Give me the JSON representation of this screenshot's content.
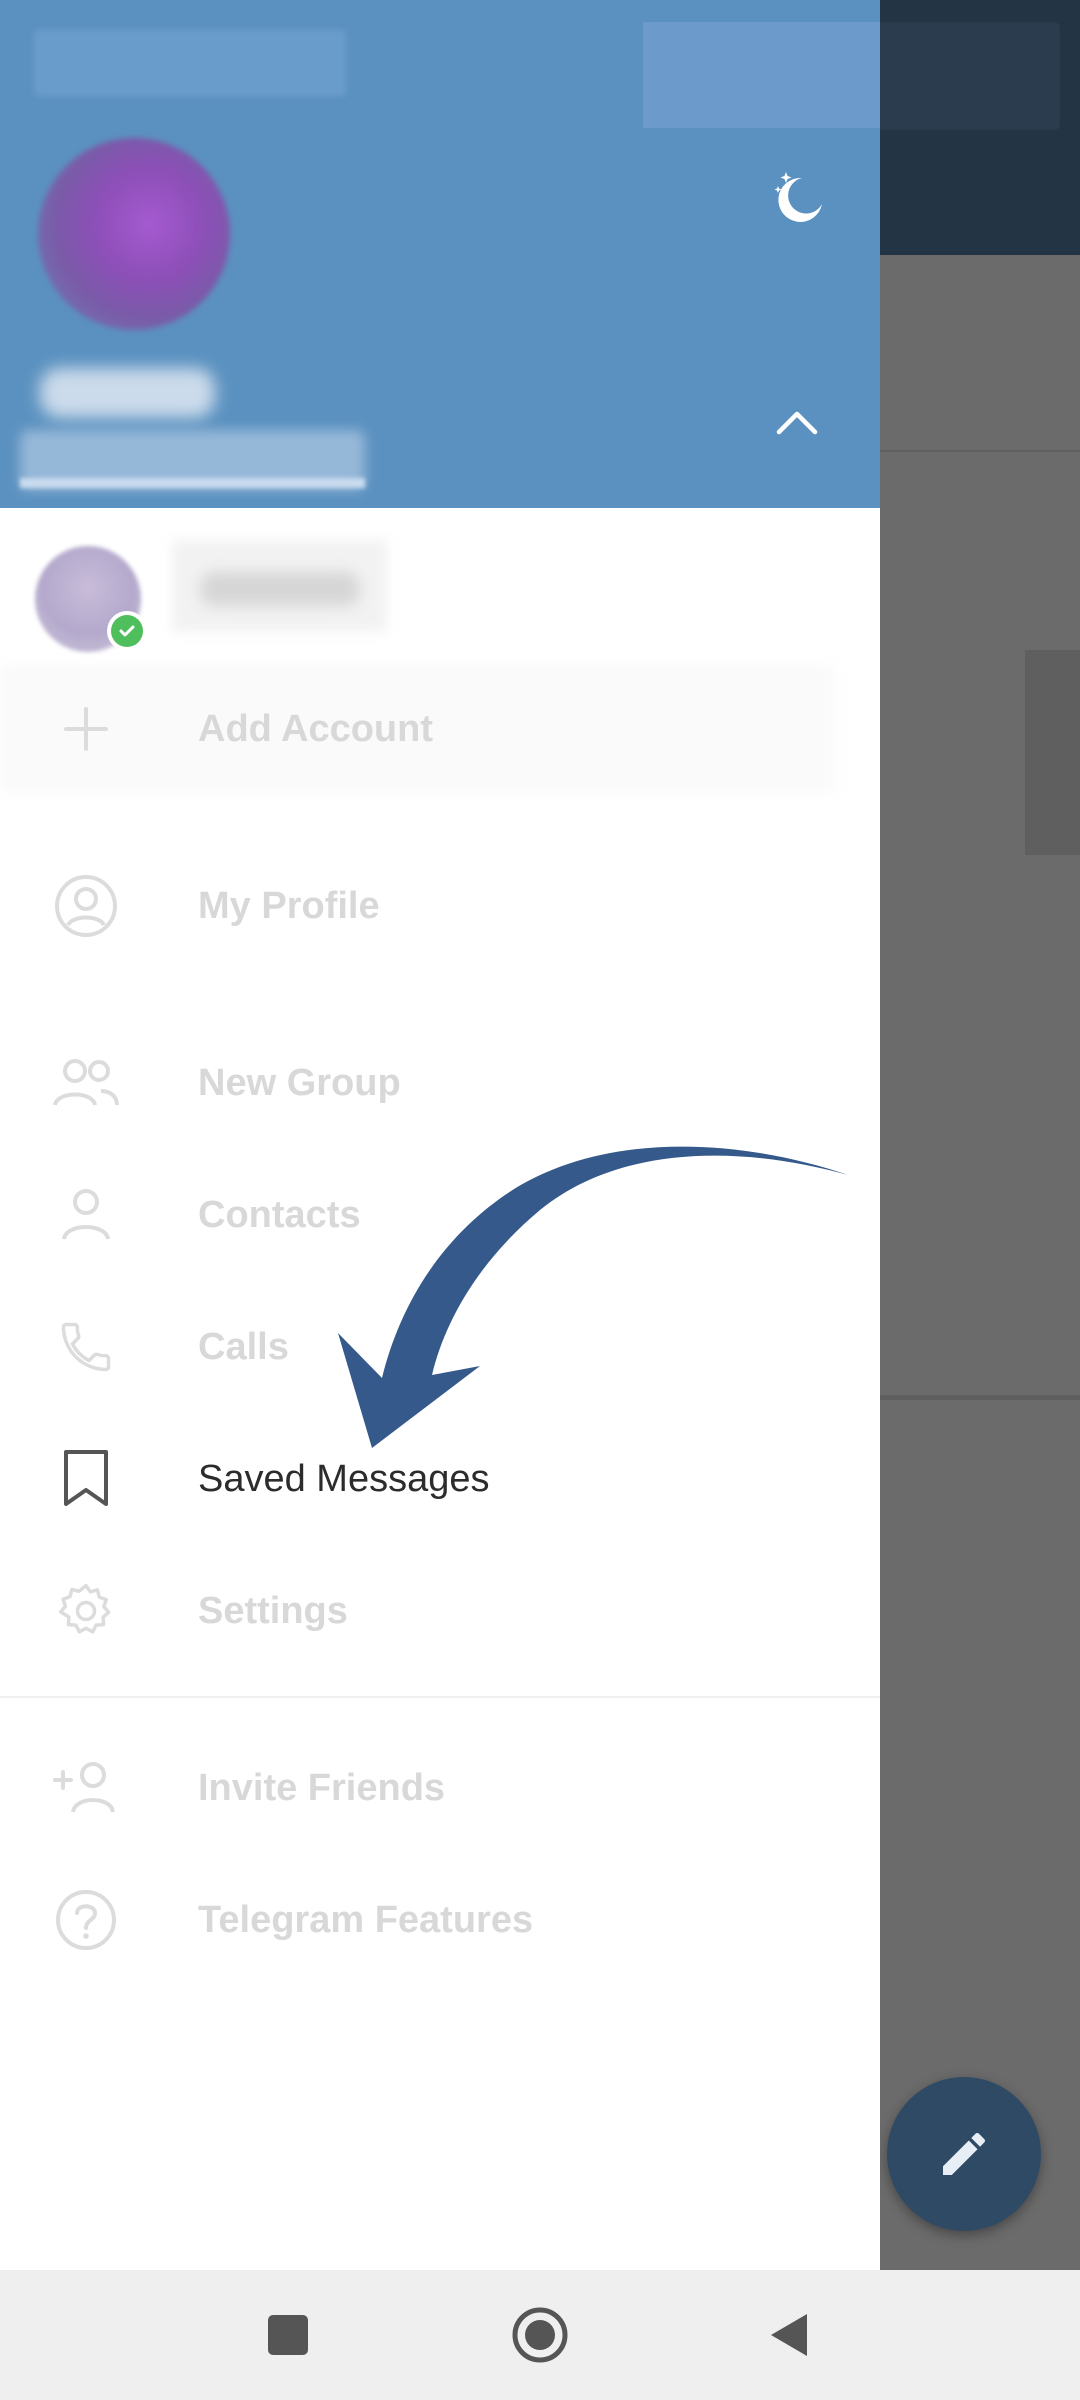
{
  "drawer": {
    "menu": [
      {
        "id": "add-account",
        "label": "Add Account",
        "icon": "plus-icon"
      },
      {
        "id": "my-profile",
        "label": "My Profile",
        "icon": "profile-circle-icon"
      },
      {
        "id": "new-group",
        "label": "New Group",
        "icon": "group-icon"
      },
      {
        "id": "contacts",
        "label": "Contacts",
        "icon": "person-icon"
      },
      {
        "id": "calls",
        "label": "Calls",
        "icon": "phone-icon"
      },
      {
        "id": "saved-messages",
        "label": "Saved Messages",
        "icon": "bookmark-icon"
      },
      {
        "id": "settings",
        "label": "Settings",
        "icon": "gear-icon"
      },
      {
        "id": "invite-friends",
        "label": "Invite Friends",
        "icon": "add-person-icon"
      },
      {
        "id": "telegram-features",
        "label": "Telegram Features",
        "icon": "question-circle-icon"
      }
    ]
  },
  "colors": {
    "header": "#5b91c0",
    "highlight_arrow": "#34598a",
    "online_badge": "#4fbe5c",
    "fab": "#2f4a65"
  },
  "navbar": {
    "buttons": [
      "recents-icon",
      "home-icon",
      "back-icon"
    ]
  }
}
